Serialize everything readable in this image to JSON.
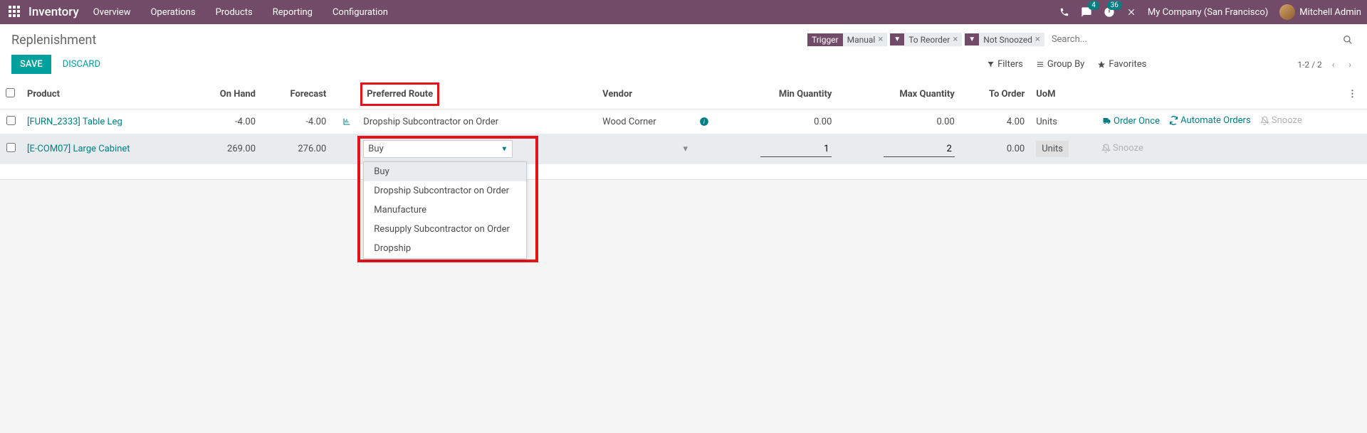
{
  "topnav": {
    "brand": "Inventory",
    "menu": [
      "Overview",
      "Operations",
      "Products",
      "Reporting",
      "Configuration"
    ],
    "messages_badge": "4",
    "activities_badge": "36",
    "company": "My Company (San Francisco)",
    "user": "Mitchell Admin"
  },
  "header": {
    "title": "Replenishment",
    "save": "SAVE",
    "discard": "DISCARD",
    "chips": [
      {
        "label": "Trigger",
        "value": "Manual"
      },
      {
        "filter": true,
        "value": "To Reorder"
      },
      {
        "filter": true,
        "value": "Not Snoozed"
      }
    ],
    "search_placeholder": "Search...",
    "filters": "Filters",
    "groupby": "Group By",
    "favorites": "Favorites",
    "pager": "1-2 / 2"
  },
  "table": {
    "headers": {
      "product": "Product",
      "onhand": "On Hand",
      "forecast": "Forecast",
      "route": "Preferred Route",
      "vendor": "Vendor",
      "minqty": "Min Quantity",
      "maxqty": "Max Quantity",
      "toorder": "To Order",
      "uom": "UoM"
    },
    "rows": [
      {
        "product": "[FURN_2333] Table Leg",
        "onhand": "-4.00",
        "forecast": "-4.00",
        "route": "Dropship Subcontractor on Order",
        "vendor": "Wood Corner",
        "minqty": "0.00",
        "maxqty": "0.00",
        "toorder": "4.00",
        "uom": "Units",
        "actions": {
          "order": "Order Once",
          "automate": "Automate Orders",
          "snooze": "Snooze"
        }
      },
      {
        "product": "[E-COM07] Large Cabinet",
        "onhand": "269.00",
        "forecast": "276.00",
        "route_input": "Buy",
        "vendor": "",
        "minqty": "1",
        "maxqty": "2",
        "toorder": "0.00",
        "uom": "Units",
        "actions": {
          "snooze": "Snooze"
        }
      }
    ],
    "dropdown_options": [
      "Buy",
      "Dropship Subcontractor on Order",
      "Manufacture",
      "Resupply Subcontractor on Order",
      "Dropship"
    ]
  }
}
